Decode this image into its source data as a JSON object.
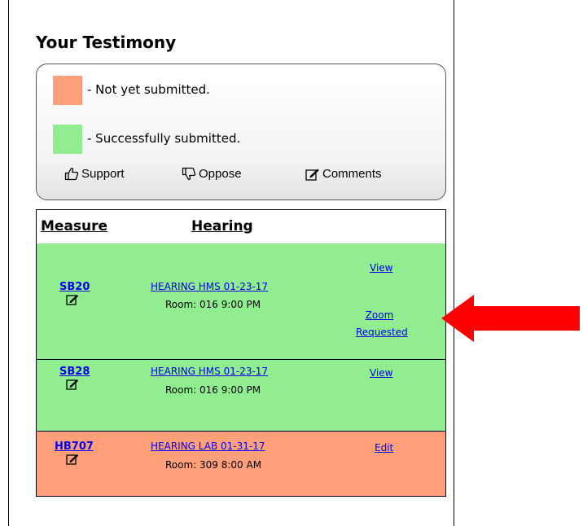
{
  "title": "Your Testimony",
  "legend": {
    "not_submitted": {
      "color": "#ffa07a",
      "text": "- Not yet submitted."
    },
    "submitted": {
      "color": "#90ee90",
      "text": "- Successfully submitted."
    },
    "actions": [
      {
        "icon": "thumbs-up-icon",
        "label": "Support"
      },
      {
        "icon": "thumbs-down-icon",
        "label": "Oppose"
      },
      {
        "icon": "edit-icon",
        "label": "Comments"
      }
    ]
  },
  "table": {
    "headers": {
      "measure": "Measure",
      "hearing": "Hearing"
    },
    "rows": [
      {
        "measure": "SB20",
        "hearing": "HEARING HMS 01-23-17",
        "room": "Room: 016 9:00 PM",
        "status_color": "#90ee90",
        "actions": [
          "View",
          "Zoom",
          "Requested"
        ]
      },
      {
        "measure": "SB28",
        "hearing": "HEARING HMS 01-23-17",
        "room": "Room: 016 9:00 PM",
        "status_color": "#90ee90",
        "actions": [
          "View"
        ]
      },
      {
        "measure": "HB707",
        "hearing": "HEARING LAB 01-31-17",
        "room": "Room: 309 8:00 AM",
        "status_color": "#ffa07a",
        "actions": [
          "Edit"
        ]
      }
    ]
  },
  "annotation": {
    "icon": "left-arrow-icon",
    "color": "#ff0000"
  }
}
